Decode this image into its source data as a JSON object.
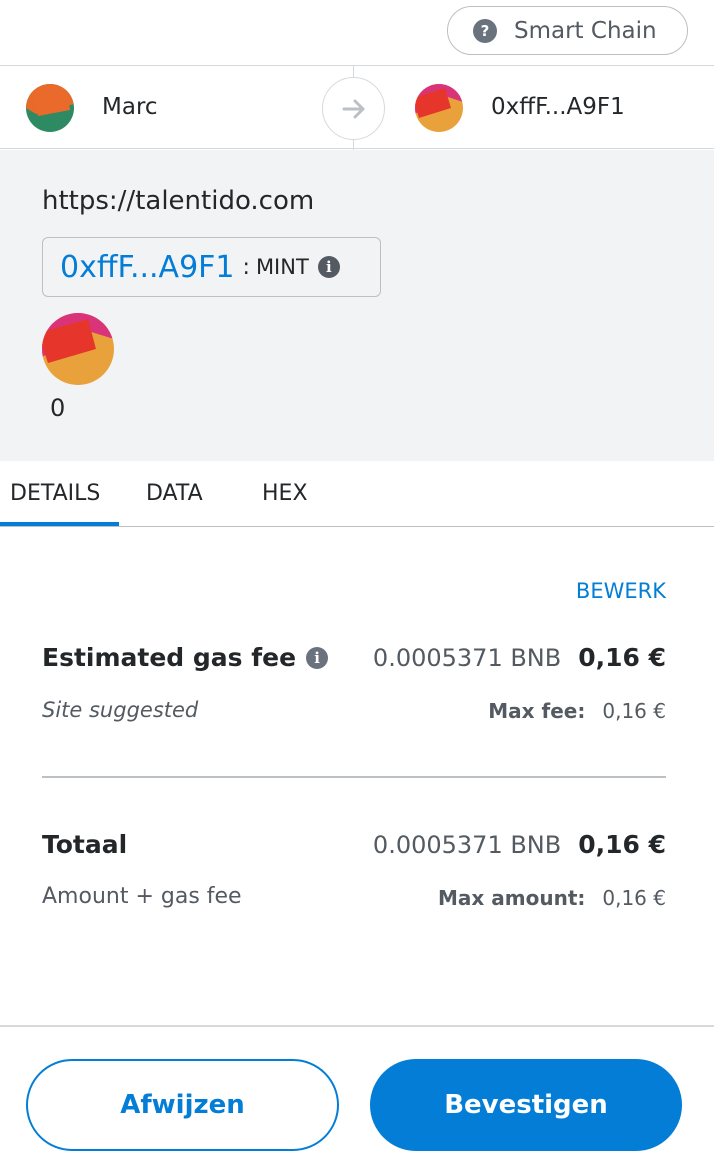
{
  "network": {
    "label": "Smart Chain",
    "help_icon": "question-icon"
  },
  "sender": {
    "name": "Marc"
  },
  "recipient": {
    "address": "0xffF...A9F1"
  },
  "origin": "https://talentido.com",
  "method": {
    "address": "0xffF...A9F1",
    "separator": ":",
    "name": "MINT"
  },
  "token_value": "0",
  "tabs": [
    {
      "label": "DETAILS",
      "active": true
    },
    {
      "label": "DATA",
      "active": false
    },
    {
      "label": "HEX",
      "active": false
    }
  ],
  "details": {
    "edit_label": "BEWERK",
    "gas": {
      "label": "Estimated gas fee",
      "native": "0.0005371 BNB",
      "fiat": "0,16 €",
      "sub_label": "Site suggested",
      "max_key": "Max fee:",
      "max_val": "0,16 €"
    },
    "total": {
      "label": "Totaal",
      "native": "0.0005371 BNB",
      "fiat": "0,16 €",
      "sub_label": "Amount + gas fee",
      "max_key": "Max amount:",
      "max_val": "0,16 €"
    }
  },
  "buttons": {
    "reject": "Afwijzen",
    "confirm": "Bevestigen"
  },
  "colors": {
    "accent": "#037dd6",
    "panel": "#f2f3f4"
  }
}
